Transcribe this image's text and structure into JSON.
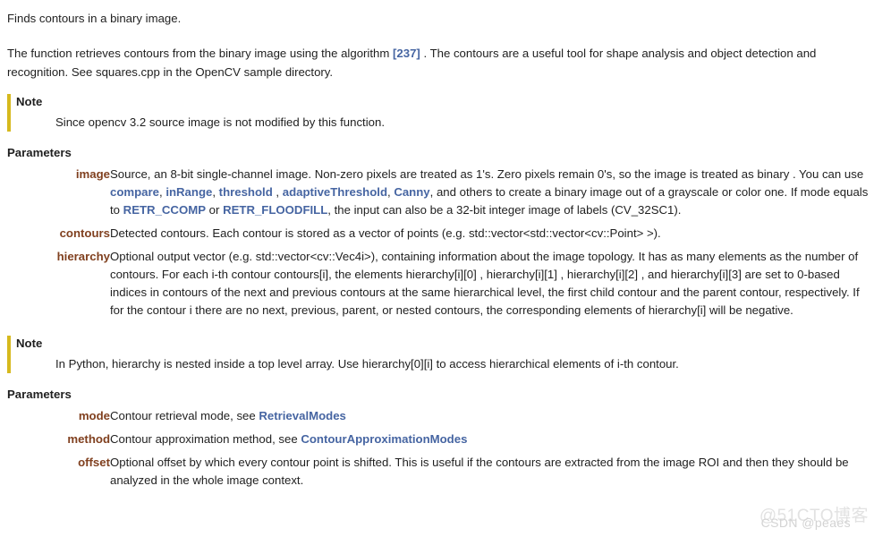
{
  "doc": {
    "summary": "Finds contours in a binary image.",
    "description_pre": "The function retrieves contours from the binary image using the algorithm ",
    "description_ref": "[237]",
    "description_post": " . The contours are a useful tool for shape analysis and object detection and recognition. See squares.cpp in the OpenCV sample directory."
  },
  "notes": [
    {
      "title": "Note",
      "body": "Since opencv 3.2 source image is not modified by this function."
    },
    {
      "title": "Note",
      "body": "In Python, hierarchy is nested inside a top level array. Use hierarchy[0][i] to access hierarchical elements of i-th contour."
    }
  ],
  "parameters_heading_1": "Parameters",
  "parameters_heading_2": "Parameters",
  "parameters_1": [
    {
      "name": "image",
      "desc_1": "Source, an 8-bit single-channel image. Non-zero pixels are treated as 1's. Zero pixels remain 0's, so the image is treated as binary . You can use ",
      "link_1": "compare",
      "desc_2": ", ",
      "link_2": "inRange",
      "desc_3": ", ",
      "link_3": "threshold",
      "desc_4": " , ",
      "link_4": "adaptiveThreshold",
      "desc_5": ", ",
      "link_5": "Canny",
      "desc_6": ", and others to create a binary image out of a grayscale or color one. If mode equals to ",
      "link_6": "RETR_CCOMP",
      "desc_7": " or ",
      "link_7": "RETR_FLOODFILL",
      "desc_8": ", the input can also be a 32-bit integer image of labels (CV_32SC1)."
    },
    {
      "name": "contours",
      "desc_1": "Detected contours. Each contour is stored as a vector of points (e.g. std::vector<std::vector<cv::Point> >)."
    },
    {
      "name": "hierarchy",
      "desc_1": "Optional output vector (e.g. std::vector<cv::Vec4i>), containing information about the image topology. It has as many elements as the number of contours. For each i-th contour contours[i], the elements hierarchy[i][0] , hierarchy[i][1] , hierarchy[i][2] , and hierarchy[i][3] are set to 0-based indices in contours of the next and previous contours at the same hierarchical level, the first child contour and the parent contour, respectively. If for the contour i there are no next, previous, parent, or nested contours, the corresponding elements of hierarchy[i] will be negative."
    }
  ],
  "parameters_2": [
    {
      "name": "mode",
      "desc_1": "Contour retrieval mode, see ",
      "link_1": "RetrievalModes",
      "desc_2": ""
    },
    {
      "name": "method",
      "desc_1": "Contour approximation method, see ",
      "link_1": "ContourApproximationModes",
      "desc_2": ""
    },
    {
      "name": "offset",
      "desc_1": "Optional offset by which every contour point is shifted. This is useful if the contours are extracted from the image ROI and then they should be analyzed in the whole image context."
    }
  ],
  "watermarks": {
    "primary": "@51CTO博客",
    "secondary": "CSDN @peaes"
  },
  "colors": {
    "link": "#4665a2",
    "param_name": "#80401f",
    "note_border": "#d6b91e",
    "text": "#1f1f1f"
  }
}
